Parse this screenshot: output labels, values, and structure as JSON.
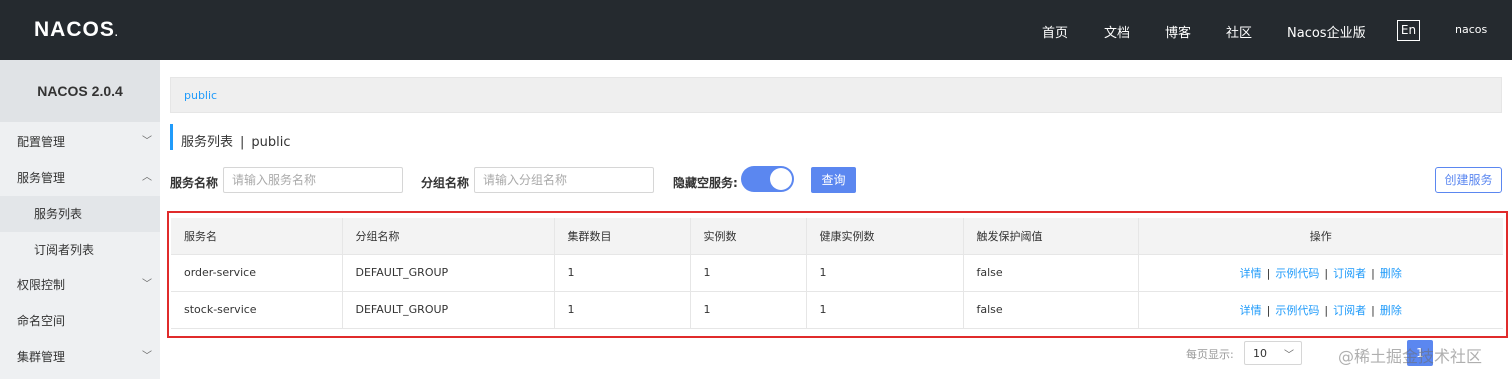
{
  "header": {
    "logo": "NACOS",
    "logo_dot": ".",
    "nav": [
      "首页",
      "文档",
      "博客",
      "社区",
      "Nacos企业版"
    ],
    "lang": "En",
    "user": "nacos"
  },
  "sidebar": {
    "title": "NACOS 2.0.4",
    "items": [
      {
        "label": "配置管理"
      },
      {
        "label": "服务管理"
      },
      {
        "label": "服务列表"
      },
      {
        "label": "订阅者列表"
      },
      {
        "label": "权限控制"
      },
      {
        "label": "命名空间"
      },
      {
        "label": "集群管理"
      }
    ]
  },
  "breadcrumb": "public",
  "page": {
    "title": "服务列表",
    "separator": "|",
    "namespace": "public"
  },
  "filters": {
    "service_name_label": "服务名称",
    "service_name_placeholder": "请输入服务名称",
    "group_name_label": "分组名称",
    "group_name_placeholder": "请输入分组名称",
    "hide_empty_label": "隐藏空服务:",
    "hide_empty_on": true,
    "query_label": "查询",
    "create_label": "创建服务"
  },
  "table": {
    "headers": [
      "服务名",
      "分组名称",
      "集群数目",
      "实例数",
      "健康实例数",
      "触发保护阈值",
      "操作"
    ],
    "rows": [
      [
        "order-service",
        "DEFAULT_GROUP",
        "1",
        "1",
        "1",
        "false"
      ],
      [
        "stock-service",
        "DEFAULT_GROUP",
        "1",
        "1",
        "1",
        "false"
      ]
    ],
    "actions": [
      "详情",
      "示例代码",
      "订阅者",
      "删除"
    ],
    "action_sep": "|"
  },
  "pagination": {
    "per_page_label": "每页显示:",
    "per_page_value": "10",
    "current_page": "1"
  },
  "watermark": "@稀土掘金技术社区",
  "colors": {
    "topbar": "#252a2f",
    "accent": "#5b87f0",
    "link": "#209bfa",
    "highlight_border": "#e02b2b"
  }
}
